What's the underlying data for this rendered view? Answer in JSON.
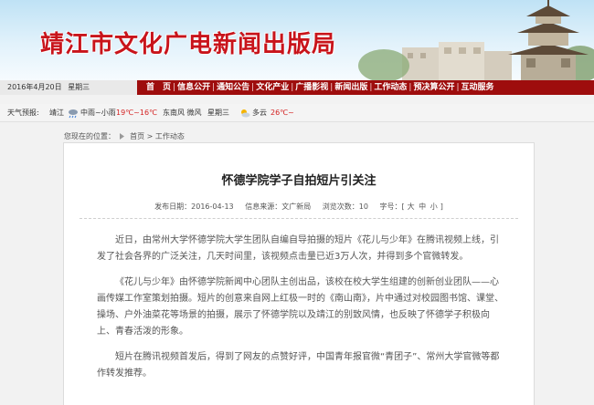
{
  "header": {
    "site_name": "靖江市文化广电新闻出版局"
  },
  "nav": {
    "date": "2016年4月20日",
    "weekday": "星期三",
    "items": [
      {
        "label": "首　页"
      },
      {
        "label": "信息公开"
      },
      {
        "label": "通知公告"
      },
      {
        "label": "文化产业"
      },
      {
        "label": "广播影视"
      },
      {
        "label": "新闻出版"
      },
      {
        "label": "工作动态"
      },
      {
        "label": "预决算公开"
      },
      {
        "label": "互动服务"
      }
    ]
  },
  "weather": {
    "label": "天气预报:",
    "city": "靖江",
    "today_condition": "中雨~小雨",
    "today_temp": "19℃~16℃",
    "wind": "东南风 微风",
    "day": "星期三",
    "tomorrow_condition": "多云",
    "tomorrow_temp": "26℃~",
    "icons": [
      "rain-cloud-icon",
      "partly-cloudy-icon"
    ]
  },
  "breadcrumb": {
    "prefix": "您现在的位置：",
    "home": "首页",
    "sep": ">",
    "current": "工作动态"
  },
  "article": {
    "title": "怀德学院学子自拍短片引关注",
    "published_label": "发布日期：",
    "published": "2016-04-13",
    "source_label": "信息来源：",
    "source": "文广新局",
    "views_label": "浏览次数：",
    "views": "10",
    "fontsize_label": "字号：",
    "font_bracket_open": "[",
    "font_bracket_close": "]",
    "font_large": "大",
    "font_medium": "中",
    "font_small": "小",
    "paragraphs": [
      "近日，由常州大学怀德学院大学生团队自编自导拍摄的短片《花儿与少年》在腾讯视频上线，引发了社会各界的广泛关注，几天时间里，该视频点击量已近3万人次，并得到多个官微转发。",
      "《花儿与少年》由怀德学院新闻中心团队主创出品，该校在校大学生组建的创新创业团队——心画传媒工作室策划拍摄。短片的创意来自网上红极一时的《南山南》，片中通过对校园图书馆、课堂、操场、户外油菜花等场景的拍摄，展示了怀德学院以及靖江的别致风情，也反映了怀德学子积极向上、青春活泼的形象。",
      "短片在腾讯视频首发后，得到了网友的点赞好评，中国青年报官微“青团子”、常州大学官微等都作转发推荐。"
    ]
  },
  "colors": {
    "brand_red": "#c8141b",
    "nav_bg": "#9e0d0d",
    "accent_temp": "#d42323"
  }
}
